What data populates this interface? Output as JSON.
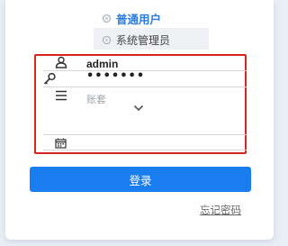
{
  "role_options": {
    "user": {
      "label": "普通用户"
    },
    "admin": {
      "label": "系统管理员"
    }
  },
  "form": {
    "username": {
      "value": "admin",
      "icon": "user-icon"
    },
    "password": {
      "value": "•••••••",
      "icon": "key-icon"
    },
    "account": {
      "placeholder": "账套",
      "icon": "list-icon",
      "dropdown_icon": "chevron-down-icon"
    },
    "date": {
      "value": "",
      "icon": "calendar-icon"
    }
  },
  "login_button": {
    "label": "登录"
  },
  "forgot_link": {
    "label": "忘记密码"
  },
  "colors": {
    "accent": "#1a7ef0",
    "selected_role_text": "#2f7ad8",
    "highlight_border": "#d9231f"
  }
}
